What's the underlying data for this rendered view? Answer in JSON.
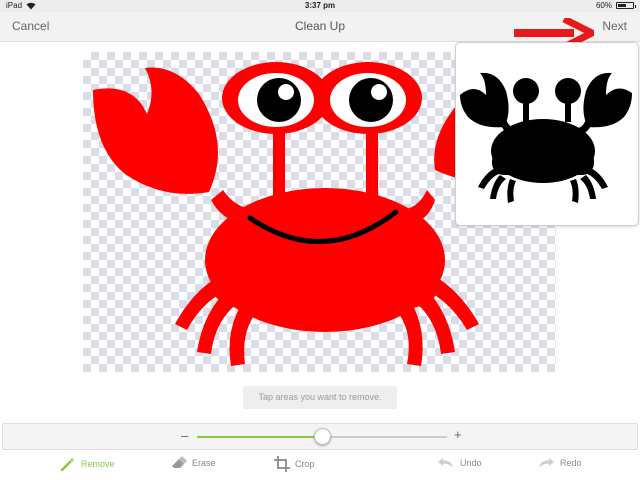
{
  "status_bar": {
    "carrier": "iPad",
    "time": "3:37 pm",
    "battery_percent": "60%",
    "battery_level": 0.6
  },
  "nav": {
    "cancel_label": "Cancel",
    "title": "Clean Up",
    "next_label": "Next"
  },
  "hint": "Tap areas you want to remove.",
  "slider": {
    "minus": "–",
    "plus": "+",
    "value": 0.5
  },
  "toolbar": {
    "remove_label": "Remove",
    "erase_label": "Erase",
    "crop_label": "Crop",
    "undo_label": "Undo",
    "redo_label": "Redo"
  },
  "colors": {
    "accent_green": "#8dc63f",
    "crab_red": "#ff0000",
    "arrow_red": "#e8191b",
    "silhouette": "#000000"
  },
  "icons": {
    "remove": "magic-wand-icon",
    "erase": "eraser-icon",
    "crop": "crop-icon",
    "undo": "undo-icon",
    "redo": "redo-icon"
  }
}
